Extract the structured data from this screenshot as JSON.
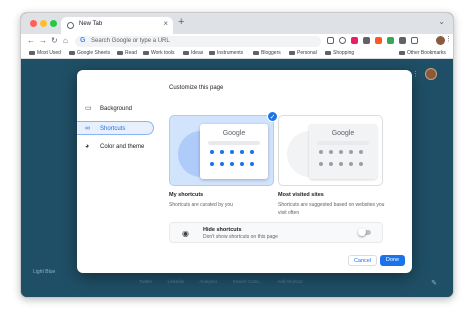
{
  "browser": {
    "tab_title": "New Tab",
    "tab_close": "×",
    "new_tab": "+",
    "tab_list": "⌄",
    "nav": {
      "back": "←",
      "forward": "→",
      "reload": "↻",
      "home": "⌂"
    },
    "omnibox_placeholder": "Search Google or type a URL",
    "omnibox_g": "G",
    "toolbar_icons": [
      "share",
      "star",
      "ext-1",
      "ext-2",
      "ext-3",
      "ext-4",
      "puzzle",
      "sidebar",
      "profile",
      "menu"
    ],
    "menu": "⋮"
  },
  "bookmarks": {
    "items": [
      "Most Used",
      "Google Sheets",
      "Read",
      "Work tools",
      "Ideas",
      "Instruments",
      "Bloggers",
      "Personal",
      "Shopping"
    ],
    "other": "Other Bookmarks"
  },
  "page": {
    "apps": "⋮⋮",
    "theme_label": "Light Blue",
    "shortcut_labels": [
      "Twitter",
      "Linkedin",
      "Analytics",
      "Search Cons...",
      "Add shortcut"
    ],
    "edit": "✎"
  },
  "dialog": {
    "title": "Customize this page",
    "sidebar": [
      {
        "label": "Background",
        "icon": "image-icon",
        "glyph": "▭"
      },
      {
        "label": "Shortcuts",
        "icon": "link-icon",
        "glyph": "∞"
      },
      {
        "label": "Color and theme",
        "icon": "palette-icon",
        "glyph": "◕"
      }
    ],
    "mock_logo": "Google",
    "check": "✓",
    "options": [
      {
        "title": "My shortcuts",
        "desc": "Shortcuts are curated by you"
      },
      {
        "title": "Most visited sites",
        "desc": "Shortcuts are suggested based on websites you visit often"
      }
    ],
    "hide": {
      "icon": "◉",
      "title": "Hide shortcuts",
      "desc": "Don't show shortcuts on this page",
      "enabled": false
    },
    "cancel": "Cancel",
    "done": "Done"
  },
  "colors": {
    "accent": "#1a73e8",
    "page_bg": "#1f4f66"
  }
}
